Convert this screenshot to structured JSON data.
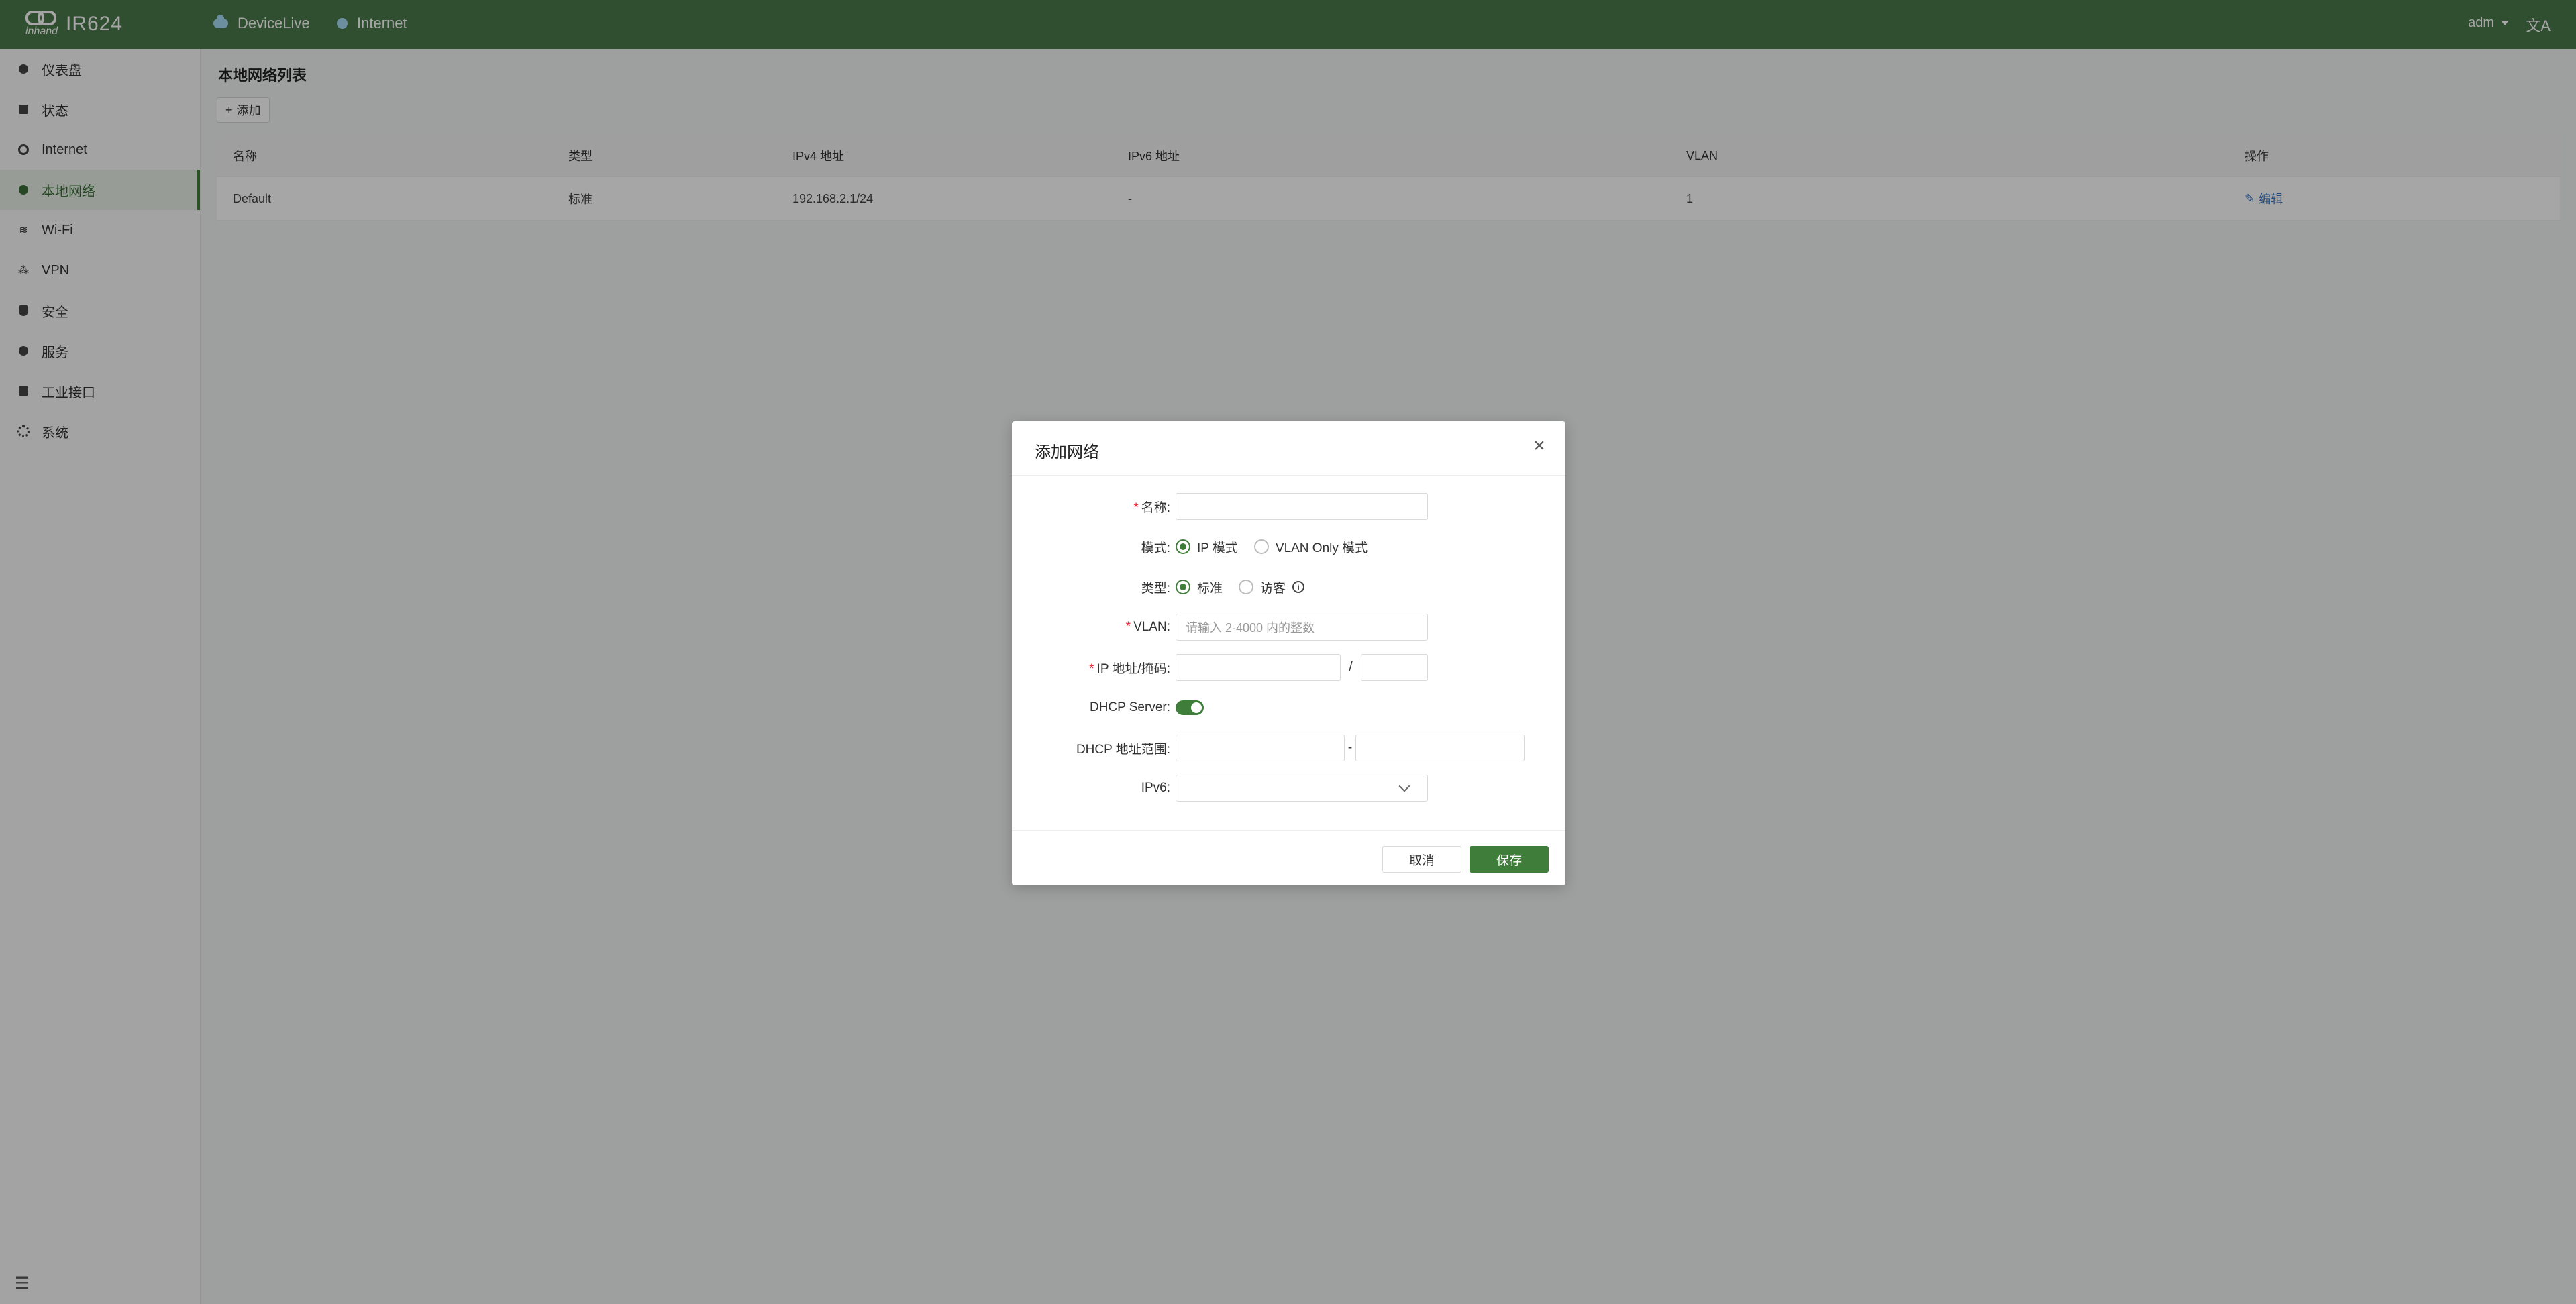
{
  "header": {
    "product": "IR624",
    "brand": "inhand",
    "status_items": [
      {
        "label": "DeviceLive",
        "icon": "cloud-icon"
      },
      {
        "label": "Internet",
        "icon": "status-dot-icon"
      }
    ],
    "user": "adm",
    "lang_icon": "translate-icon"
  },
  "sidebar": {
    "items": [
      {
        "label": "仪表盘",
        "icon": "dashboard-icon"
      },
      {
        "label": "状态",
        "icon": "status-icon"
      },
      {
        "label": "Internet",
        "icon": "internet-icon"
      },
      {
        "label": "本地网络",
        "icon": "local-network-icon",
        "active": true
      },
      {
        "label": "Wi-Fi",
        "icon": "wifi-icon"
      },
      {
        "label": "VPN",
        "icon": "vpn-icon"
      },
      {
        "label": "安全",
        "icon": "shield-icon"
      },
      {
        "label": "服务",
        "icon": "service-icon"
      },
      {
        "label": "工业接口",
        "icon": "industrial-interface-icon"
      },
      {
        "label": "系统",
        "icon": "gear-icon"
      }
    ]
  },
  "main": {
    "title": "本地网络列表",
    "add_label": "添加",
    "table": {
      "columns": [
        "名称",
        "类型",
        "IPv4 地址",
        "IPv6 地址",
        "VLAN",
        "操作"
      ],
      "rows": [
        {
          "name": "Default",
          "type": "标准",
          "ipv4": "192.168.2.1/24",
          "ipv6": "-",
          "vlan": "1",
          "action": "编辑"
        }
      ]
    }
  },
  "modal": {
    "title": "添加网络",
    "fields": {
      "name_label": "名称:",
      "mode_label": "模式:",
      "mode_options": [
        "IP 模式",
        "VLAN Only 模式"
      ],
      "type_label": "类型:",
      "type_options": [
        "标准",
        "访客"
      ],
      "vlan_label": "VLAN:",
      "vlan_placeholder": "请输入 2-4000 内的整数",
      "ip_label": "IP 地址/掩码:",
      "ip_separator": "/",
      "dhcp_label": "DHCP Server:",
      "dhcp_range_label": "DHCP 地址范围:",
      "dhcp_range_separator": "-",
      "ipv6_label": "IPv6:"
    },
    "cancel_label": "取消",
    "save_label": "保存"
  }
}
